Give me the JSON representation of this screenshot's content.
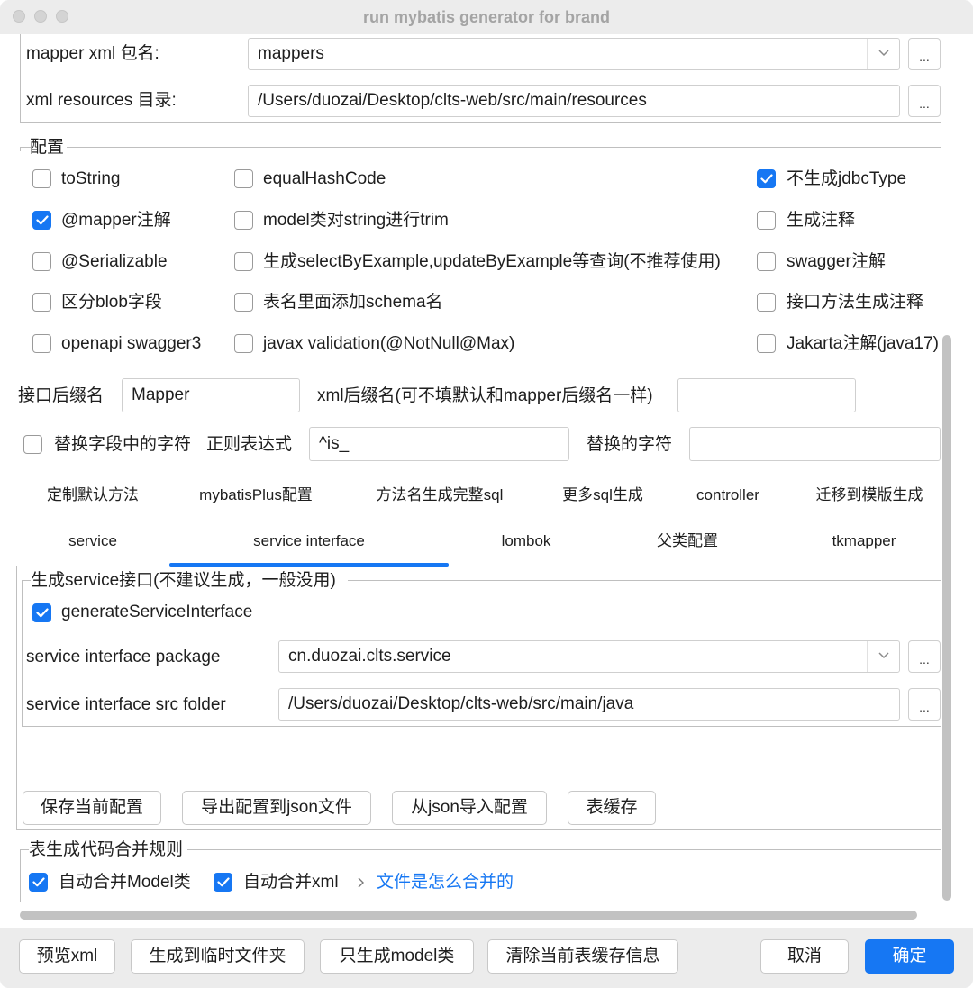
{
  "window": {
    "title": "run mybatis generator for brand"
  },
  "paths": {
    "mapper_xml_label": "mapper xml 包名:",
    "mapper_xml_value": "mappers",
    "xml_resources_label": "xml resources 目录:",
    "xml_resources_value": "/Users/duozai/Desktop/clts-web/src/main/resources",
    "browse_label": "..."
  },
  "config": {
    "title": "配置",
    "options": [
      {
        "label": "toString",
        "checked": false
      },
      {
        "label": "equalHashCode",
        "checked": false
      },
      {
        "label": "不生成jdbcType",
        "checked": true
      },
      {
        "label": "@mapper注解",
        "checked": true
      },
      {
        "label": "model类对string进行trim",
        "checked": false
      },
      {
        "label": "生成注释",
        "checked": false
      },
      {
        "label": "@Serializable",
        "checked": false
      },
      {
        "label": "生成selectByExample,updateByExample等查询(不推荐使用)",
        "checked": false
      },
      {
        "label": "swagger注解",
        "checked": false
      },
      {
        "label": "区分blob字段",
        "checked": false
      },
      {
        "label": "表名里面添加schema名",
        "checked": false
      },
      {
        "label": "接口方法生成注释",
        "checked": false
      },
      {
        "label": "openapi swagger3",
        "checked": false
      },
      {
        "label": "javax validation(@NotNull@Max)",
        "checked": false
      },
      {
        "label": "Jakarta注解(java17)",
        "checked": false
      }
    ]
  },
  "suffix": {
    "interface_label": "接口后缀名",
    "interface_value": "Mapper",
    "xml_label": "xml后缀名(可不填默认和mapper后缀名一样)",
    "xml_value": ""
  },
  "replace": {
    "checkbox_label": "替换字段中的字符",
    "checked": false,
    "regex_label": "正则表达式",
    "regex_value": "^is_",
    "replacement_label": "替换的字符",
    "replacement_value": ""
  },
  "tabs": {
    "row1": [
      "定制默认方法",
      "mybatisPlus配置",
      "方法名生成完整sql",
      "更多sql生成",
      "controller",
      "迁移到模版生成"
    ],
    "row2": [
      "service",
      "service interface",
      "lombok",
      "父类配置",
      "tkmapper"
    ],
    "active": "service interface"
  },
  "service": {
    "group_title": "生成service接口(不建议生成，一般没用)",
    "generate_label": "generateServiceInterface",
    "generate_checked": true,
    "package_label": "service interface package",
    "package_value": "cn.duozai.clts.service",
    "src_label": "service interface src folder",
    "src_value": "/Users/duozai/Desktop/clts-web/src/main/java"
  },
  "actions": {
    "save": "保存当前配置",
    "export": "导出配置到json文件",
    "import": "从json导入配置",
    "cache": "表缓存"
  },
  "merge": {
    "title": "表生成代码合并规则",
    "model_label": "自动合并Model类",
    "model_checked": true,
    "xml_label": "自动合并xml",
    "xml_checked": true,
    "link_label": "文件是怎么合并的"
  },
  "footer": {
    "preview": "预览xml",
    "temp": "生成到临时文件夹",
    "model_only": "只生成model类",
    "clear_cache": "清除当前表缓存信息",
    "cancel": "取消",
    "ok": "确定"
  },
  "colors": {
    "accent": "#1677f3",
    "window_bg": "#ececec",
    "content_bg": "#ffffff"
  }
}
